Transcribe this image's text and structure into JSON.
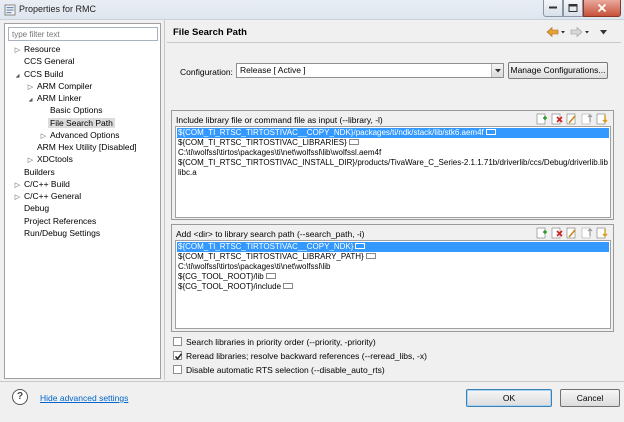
{
  "window": {
    "title": "Properties for RMC"
  },
  "left": {
    "filter_placeholder": "type filter text",
    "tree": [
      {
        "label": "Resource",
        "twisty": "closed",
        "indent": 0
      },
      {
        "label": "CCS General",
        "twisty": "none",
        "indent": 0
      },
      {
        "label": "CCS Build",
        "twisty": "open",
        "indent": 0
      },
      {
        "label": "ARM Compiler",
        "twisty": "closed",
        "indent": 1
      },
      {
        "label": "ARM Linker",
        "twisty": "open",
        "indent": 1
      },
      {
        "label": "Basic Options",
        "twisty": "none",
        "indent": 2
      },
      {
        "label": "File Search Path",
        "twisty": "none",
        "indent": 2,
        "selected": true
      },
      {
        "label": "Advanced Options",
        "twisty": "closed",
        "indent": 2
      },
      {
        "label": "ARM Hex Utility  [Disabled]",
        "twisty": "none",
        "indent": 1
      },
      {
        "label": "XDCtools",
        "twisty": "closed",
        "indent": 1
      },
      {
        "label": "Builders",
        "twisty": "none",
        "indent": 0
      },
      {
        "label": "C/C++ Build",
        "twisty": "closed",
        "indent": 0
      },
      {
        "label": "C/C++ General",
        "twisty": "closed",
        "indent": 0
      },
      {
        "label": "Debug",
        "twisty": "none",
        "indent": 0
      },
      {
        "label": "Project References",
        "twisty": "none",
        "indent": 0
      },
      {
        "label": "Run/Debug Settings",
        "twisty": "none",
        "indent": 0
      }
    ]
  },
  "main": {
    "title": "File Search Path",
    "configuration_label": "Configuration:",
    "configuration_value": "Release  [ Active ]",
    "manage_button": "Manage Configurations...",
    "library_section": {
      "header": "Include library file or command file as input (--library, -l)",
      "items": [
        {
          "text": "${COM_TI_RTSC_TIRTOSTIVAC__COPY_NDK}/packages/ti/ndk/stack/lib/stk6.aem4f",
          "more": true,
          "selected": true
        },
        {
          "text": "${COM_TI_RTSC_TIRTOSTIVAC_LIBRARIES}",
          "more": true
        },
        {
          "text": "C:\\ti\\wolfssl\\tirtos\\packages\\ti\\net\\wolfssl\\lib\\wolfssl.aem4f",
          "more": false
        },
        {
          "text": "${COM_TI_RTSC_TIRTOSTIVAC_INSTALL_DIR}/products/TivaWare_C_Series-2.1.1.71b/driverlib/ccs/Debug/driverlib.lib",
          "more": true
        },
        {
          "text": "libc.a",
          "more": false
        }
      ]
    },
    "search_section": {
      "header": "Add <dir> to library search path (--search_path, -i)",
      "items": [
        {
          "text": "${COM_TI_RTSC_TIRTOSTIVAC__COPY_NDK}",
          "more": true,
          "selected": true
        },
        {
          "text": "${COM_TI_RTSC_TIRTOSTIVAC_LIBRARY_PATH}",
          "more": true
        },
        {
          "text": "C:\\ti\\wolfssl\\tirtos\\packages\\ti\\net\\wolfssl\\lib",
          "more": false
        },
        {
          "text": "${CG_TOOL_ROOT}/lib",
          "more": true
        },
        {
          "text": "${CG_TOOL_ROOT}/include",
          "more": true
        }
      ]
    },
    "options": [
      {
        "label": "Search libraries in priority order (--priority, -priority)",
        "checked": false
      },
      {
        "label": "Reread libraries; resolve backward references (--reread_libs, -x)",
        "checked": true
      },
      {
        "label": "Disable automatic RTS selection (--disable_auto_rts)",
        "checked": false
      }
    ]
  },
  "footer": {
    "advanced_link": "Hide advanced settings",
    "ok_label": "OK",
    "cancel_label": "Cancel"
  }
}
